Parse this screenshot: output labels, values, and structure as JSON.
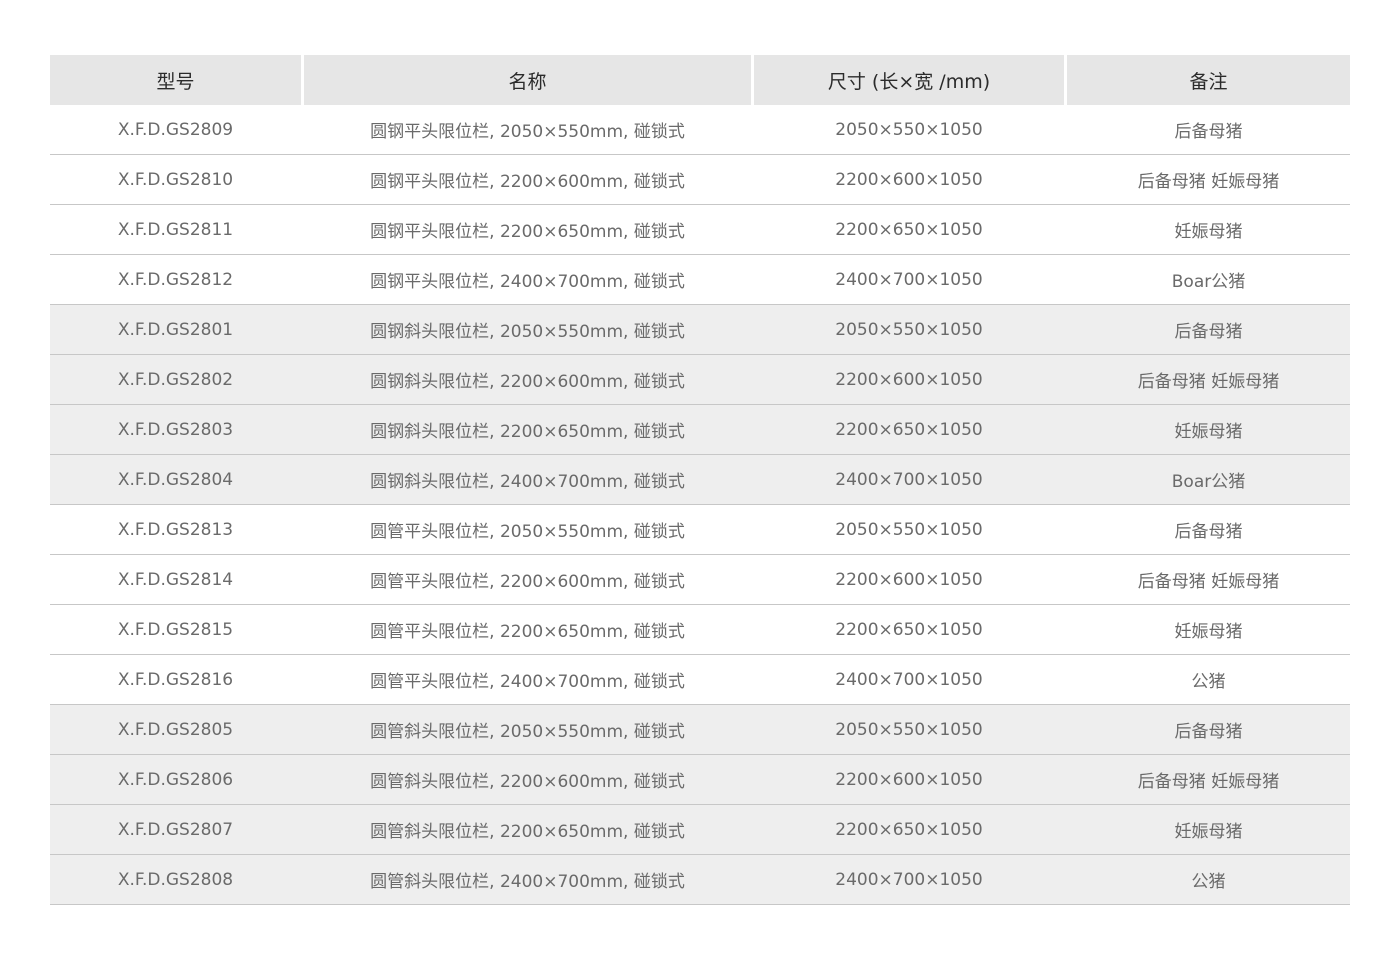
{
  "table": {
    "headers": [
      "型号",
      "名称",
      "尺寸 (长×宽 /mm)",
      "备注"
    ],
    "rows": [
      {
        "model": "X.F.D.GS2809",
        "name": "圆钢平头限位栏, 2050×550mm, 碰锁式",
        "size": "2050×550×1050",
        "note": "后备母猪",
        "shaded": false
      },
      {
        "model": "X.F.D.GS2810",
        "name": "圆钢平头限位栏, 2200×600mm, 碰锁式",
        "size": "2200×600×1050",
        "note": "后备母猪 妊娠母猪",
        "shaded": false
      },
      {
        "model": "X.F.D.GS2811",
        "name": "圆钢平头限位栏, 2200×650mm, 碰锁式",
        "size": "2200×650×1050",
        "note": "妊娠母猪",
        "shaded": false
      },
      {
        "model": "X.F.D.GS2812",
        "name": "圆钢平头限位栏, 2400×700mm, 碰锁式",
        "size": "2400×700×1050",
        "note": "Boar公猪",
        "shaded": false
      },
      {
        "model": "X.F.D.GS2801",
        "name": "圆钢斜头限位栏, 2050×550mm, 碰锁式",
        "size": "2050×550×1050",
        "note": "后备母猪",
        "shaded": true
      },
      {
        "model": "X.F.D.GS2802",
        "name": "圆钢斜头限位栏, 2200×600mm, 碰锁式",
        "size": "2200×600×1050",
        "note": "后备母猪 妊娠母猪",
        "shaded": true
      },
      {
        "model": "X.F.D.GS2803",
        "name": "圆钢斜头限位栏, 2200×650mm, 碰锁式",
        "size": "2200×650×1050",
        "note": "妊娠母猪",
        "shaded": true
      },
      {
        "model": "X.F.D.GS2804",
        "name": "圆钢斜头限位栏, 2400×700mm, 碰锁式",
        "size": "2400×700×1050",
        "note": "Boar公猪",
        "shaded": true
      },
      {
        "model": "X.F.D.GS2813",
        "name": "圆管平头限位栏, 2050×550mm, 碰锁式",
        "size": "2050×550×1050",
        "note": "后备母猪",
        "shaded": false
      },
      {
        "model": "X.F.D.GS2814",
        "name": "圆管平头限位栏, 2200×600mm, 碰锁式",
        "size": "2200×600×1050",
        "note": "后备母猪 妊娠母猪",
        "shaded": false
      },
      {
        "model": "X.F.D.GS2815",
        "name": "圆管平头限位栏, 2200×650mm, 碰锁式",
        "size": "2200×650×1050",
        "note": "妊娠母猪",
        "shaded": false
      },
      {
        "model": "X.F.D.GS2816",
        "name": "圆管平头限位栏, 2400×700mm, 碰锁式",
        "size": "2400×700×1050",
        "note": "公猪",
        "shaded": false
      },
      {
        "model": "X.F.D.GS2805",
        "name": "圆管斜头限位栏, 2050×550mm, 碰锁式",
        "size": "2050×550×1050",
        "note": "后备母猪",
        "shaded": true
      },
      {
        "model": "X.F.D.GS2806",
        "name": "圆管斜头限位栏, 2200×600mm, 碰锁式",
        "size": "2200×600×1050",
        "note": "后备母猪 妊娠母猪",
        "shaded": true
      },
      {
        "model": "X.F.D.GS2807",
        "name": "圆管斜头限位栏, 2200×650mm, 碰锁式",
        "size": "2200×650×1050",
        "note": "妊娠母猪",
        "shaded": true
      },
      {
        "model": "X.F.D.GS2808",
        "name": "圆管斜头限位栏, 2400×700mm, 碰锁式",
        "size": "2400×700×1050",
        "note": "公猪",
        "shaded": true
      }
    ]
  }
}
